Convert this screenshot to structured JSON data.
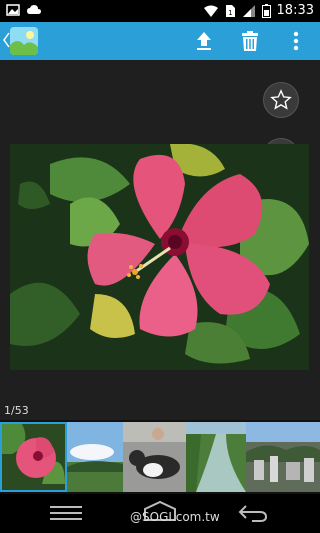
{
  "status_bar": {
    "time": "18:33"
  },
  "action_bar": {
    "icons": [
      "back-icon",
      "gallery-app-icon",
      "upload-icon",
      "trash-icon",
      "overflow-menu-icon"
    ],
    "accent_color": "#2a9fd8"
  },
  "viewer": {
    "counter": "1/53",
    "photo_subject": "pink hibiscus flower"
  },
  "nav_bar": {
    "watermark": "@SOGI.com.tw"
  }
}
